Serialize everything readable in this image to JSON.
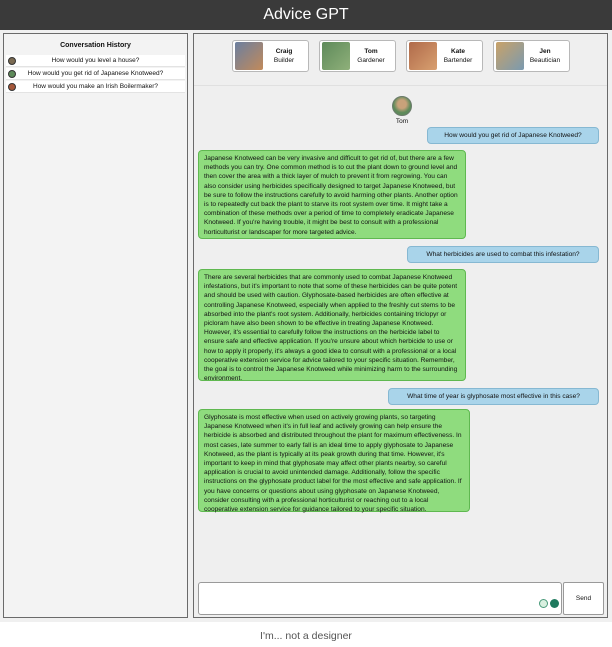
{
  "app": {
    "title": "Advice GPT"
  },
  "history": {
    "title": "Conversation History",
    "items": [
      {
        "label": "How would you level a house?",
        "avatar_color": "#7a6a52"
      },
      {
        "label": "How would you get rid of Japanese Knotweed?",
        "avatar_color": "#5e8a5a"
      },
      {
        "label": "How would you make an Irish Boilermaker?",
        "avatar_color": "#a4573a"
      }
    ]
  },
  "personas": [
    {
      "name": "Craig",
      "role": "Builder",
      "color": "#6b7fa0"
    },
    {
      "name": "Tom",
      "role": "Gardener",
      "color": "#5e8a5a"
    },
    {
      "name": "Kate",
      "role": "Bartender",
      "color": "#b06a4a"
    },
    {
      "name": "Jen",
      "role": "Beautician",
      "color": "#c9a268"
    }
  ],
  "chat": {
    "active_persona": "Tom",
    "messages": [
      {
        "role": "user",
        "text": "How would you get rid of Japanese Knotweed?"
      },
      {
        "role": "assistant",
        "text": "Japanese Knotweed can be very invasive and difficult to get rid of, but there are a few methods you can try. One common method is to cut the plant down to ground level and then cover the area with a thick layer of mulch to prevent it from regrowing. You can also consider using herbicides specifically designed to target Japanese Knotweed, but be sure to follow the instructions carefully to avoid harming other plants. Another option is to repeatedly cut back the plant to starve its root system over time. It might take a combination of these methods over a period of time to completely eradicate Japanese Knotweed. If you're having trouble, it might be best to consult with a professional horticulturist or landscaper for more targeted advice."
      },
      {
        "role": "user",
        "text": "What herbicides are used to combat this infestation?"
      },
      {
        "role": "assistant",
        "text": "There are several herbicides that are commonly used to combat Japanese Knotweed infestations, but it's important to note that some of these herbicides can be quite potent and should be used with caution. Glyphosate-based herbicides are often effective at controlling Japanese Knotweed, especially when applied to the freshly cut stems to be absorbed into the plant's root system. Additionally, herbicides containing triclopyr or picloram have also been shown to be effective in treating Japanese Knotweed. However, it's essential to carefully follow the instructions on the herbicide label to ensure safe and effective application. If you're unsure about which herbicide to use or how to apply it properly, it's always a good idea to consult with a professional or a local cooperative extension service for advice tailored to your specific situation. Remember, the goal is to control the Japanese Knotweed while minimizing harm to the surrounding environment."
      },
      {
        "role": "user",
        "text": "What time of year is glyphosate most effective in this case?"
      },
      {
        "role": "assistant",
        "text": "Glyphosate is most effective when used on actively growing plants, so targeting Japanese Knotweed when it's in full leaf and actively growing can help ensure the herbicide is absorbed and distributed throughout the plant for maximum effectiveness. In most cases, late summer to early fall is an ideal time to apply glyphosate to Japanese Knotweed, as the plant is typically at its peak growth during that time. However, it's important to keep in mind that glyphosate may affect other plants nearby, so careful application is crucial to avoid unintended damage. Additionally, follow the specific instructions on the glyphosate product label for the most effective and safe application. If you have concerns or questions about using glyphosate on Japanese Knotweed, consider consulting with a professional horticulturist or reaching out to a local cooperative extension service for guidance tailored to your specific situation."
      }
    ]
  },
  "input": {
    "value": "",
    "send_label": "Send"
  },
  "caption": "I'm... not a designer"
}
